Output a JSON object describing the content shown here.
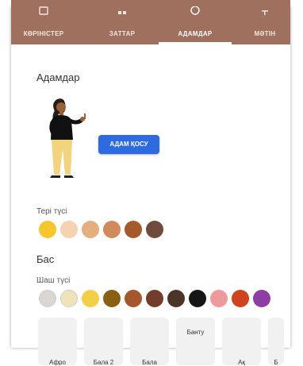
{
  "tabs": [
    {
      "label": "КӨРІНІСТЕР",
      "icon": "image-icon",
      "active": false
    },
    {
      "label": "ЗАТТАР",
      "icon": "shapes-icon",
      "active": false
    },
    {
      "label": "АДАМДАР",
      "icon": "person-icon",
      "active": true
    },
    {
      "label": "МӘТІН",
      "icon": "text-icon",
      "active": false
    }
  ],
  "people": {
    "title": "Адамдар",
    "add_button": "АДАМ ҚОСУ",
    "skin_label": "Тері түсі",
    "skin_colors": [
      "#f6c62b",
      "#f5d2b0",
      "#e4ae7f",
      "#d08a5b",
      "#a55a2a",
      "#6e4b3a"
    ],
    "head_title": "Бас",
    "hair_label": "Шаш түсі",
    "hair_colors": [
      "#d9d6d4",
      "#f0e3b8",
      "#f3cf45",
      "#8a6112",
      "#a5562d",
      "#743c2a",
      "#4d3429",
      "#161616",
      "#ef9a9a",
      "#d0431d",
      "#8d3ea3"
    ],
    "hair_styles": [
      "Афро",
      "Бала 2",
      "Бала",
      "Банту",
      "Ақ",
      "Б"
    ]
  }
}
